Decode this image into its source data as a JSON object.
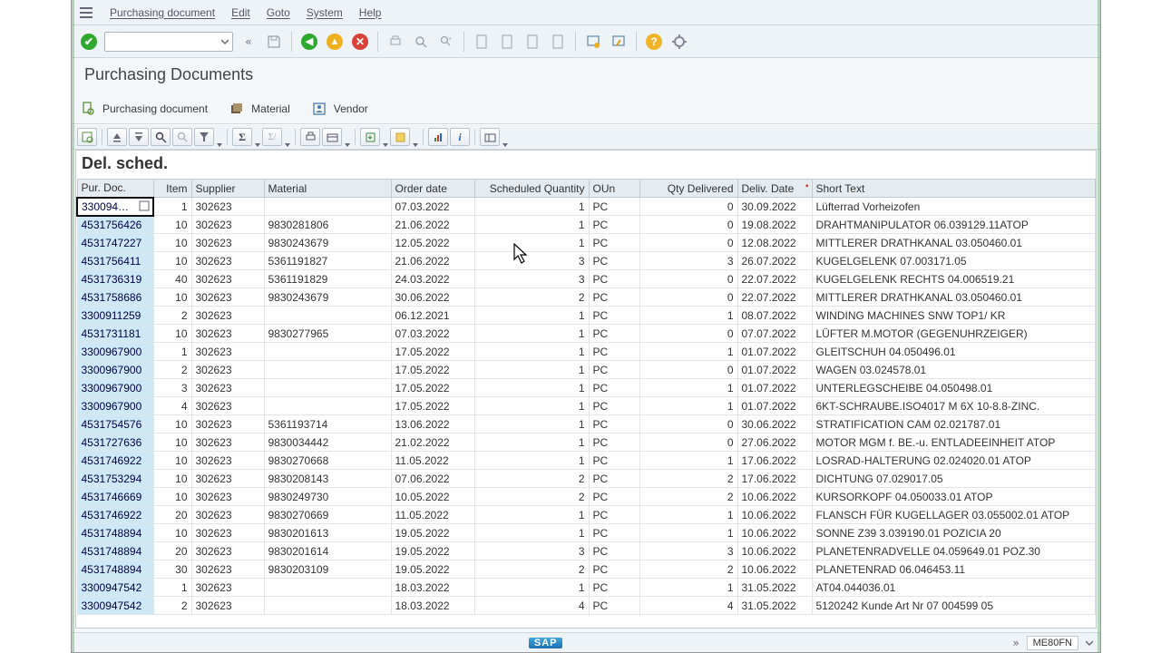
{
  "menu": {
    "items": [
      "Purchasing document",
      "Edit",
      "Goto",
      "System",
      "Help"
    ]
  },
  "title": "Purchasing Documents",
  "subtoolbar": {
    "purchasing": "Purchasing document",
    "material": "Material",
    "vendor": "Vendor"
  },
  "grid_title": "Del. sched.",
  "columns": [
    "Pur. Doc.",
    "Item",
    "Supplier",
    "Material",
    "Order date",
    "Scheduled Quantity",
    "OUn",
    "Qty Delivered",
    "Deliv. Date",
    "Short Text"
  ],
  "col_align": [
    "left",
    "right",
    "left",
    "left",
    "left",
    "right",
    "left",
    "right",
    "left",
    "left"
  ],
  "sorted_col": 8,
  "rows": [
    [
      "330094…",
      "1",
      "302623",
      "",
      "07.03.2022",
      "1",
      "PC",
      "0",
      "30.09.2022",
      "Lüfterrad Vorheizofen"
    ],
    [
      "4531756426",
      "10",
      "302623",
      "9830281806",
      "21.06.2022",
      "1",
      "PC",
      "0",
      "19.08.2022",
      "DRAHTMANIPULATOR 06.039129.11ATOP"
    ],
    [
      "4531747227",
      "10",
      "302623",
      "9830243679",
      "12.05.2022",
      "1",
      "PC",
      "0",
      "12.08.2022",
      "MITTLERER DRATHKANAL 03.050460.01"
    ],
    [
      "4531756411",
      "10",
      "302623",
      "5361191827",
      "21.06.2022",
      "3",
      "PC",
      "3",
      "26.07.2022",
      "KUGELGELENK 07.003171.05"
    ],
    [
      "4531736319",
      "40",
      "302623",
      "5361191829",
      "24.03.2022",
      "3",
      "PC",
      "0",
      "22.07.2022",
      "KUGELGELENK RECHTS 04.006519.21"
    ],
    [
      "4531758686",
      "10",
      "302623",
      "9830243679",
      "30.06.2022",
      "2",
      "PC",
      "0",
      "22.07.2022",
      "MITTLERER DRATHKANAL 03.050460.01"
    ],
    [
      "3300911259",
      "2",
      "302623",
      "",
      "06.12.2021",
      "1",
      "PC",
      "1",
      "08.07.2022",
      "WINDING MACHINES SNW TOP1/ KR"
    ],
    [
      "4531731181",
      "10",
      "302623",
      "9830277965",
      "07.03.2022",
      "1",
      "PC",
      "0",
      "07.07.2022",
      "LÜFTER M.MOTOR (GEGENUHRZEIGER)"
    ],
    [
      "3300967900",
      "1",
      "302623",
      "",
      "17.05.2022",
      "1",
      "PC",
      "1",
      "01.07.2022",
      "GLEITSCHUH 04.050496.01"
    ],
    [
      "3300967900",
      "2",
      "302623",
      "",
      "17.05.2022",
      "1",
      "PC",
      "0",
      "01.07.2022",
      "WAGEN  03.024578.01"
    ],
    [
      "3300967900",
      "3",
      "302623",
      "",
      "17.05.2022",
      "1",
      "PC",
      "1",
      "01.07.2022",
      "UNTERLEGSCHEIBE  04.050498.01"
    ],
    [
      "3300967900",
      "4",
      "302623",
      "",
      "17.05.2022",
      "1",
      "PC",
      "1",
      "01.07.2022",
      "6KT-SCHRAUBE.ISO4017 M 6X 10-8.8-ZINC."
    ],
    [
      "4531754576",
      "10",
      "302623",
      "5361193714",
      "13.06.2022",
      "1",
      "PC",
      "0",
      "30.06.2022",
      "STRATIFICATION CAM 02.021787.01"
    ],
    [
      "4531727636",
      "10",
      "302623",
      "9830034442",
      "21.02.2022",
      "1",
      "PC",
      "0",
      "27.06.2022",
      "MOTOR MGM  f. BE.-u. ENTLADEEINHEIT ATOP"
    ],
    [
      "4531746922",
      "10",
      "302623",
      "9830270668",
      "11.05.2022",
      "1",
      "PC",
      "1",
      "17.06.2022",
      "LOSRAD-HALTERUNG  02.024020.01 ATOP"
    ],
    [
      "4531753294",
      "10",
      "302623",
      "9830208143",
      "07.06.2022",
      "2",
      "PC",
      "2",
      "17.06.2022",
      "DICHTUNG 07.029017.05"
    ],
    [
      "4531746669",
      "10",
      "302623",
      "9830249730",
      "10.05.2022",
      "2",
      "PC",
      "2",
      "10.06.2022",
      "KURSORKOPF 04.050033.01 ATOP"
    ],
    [
      "4531746922",
      "20",
      "302623",
      "9830270669",
      "11.05.2022",
      "1",
      "PC",
      "1",
      "10.06.2022",
      "FLANSCH FÜR KUGELLAGER 03.055002.01 ATOP"
    ],
    [
      "4531748894",
      "10",
      "302623",
      "9830201613",
      "19.05.2022",
      "1",
      "PC",
      "1",
      "10.06.2022",
      "SONNE Z39 3.039190.01 POZICIA 20"
    ],
    [
      "4531748894",
      "20",
      "302623",
      "9830201614",
      "19.05.2022",
      "3",
      "PC",
      "3",
      "10.06.2022",
      "PLANETENRADVELLE 04.059649.01 POZ.30"
    ],
    [
      "4531748894",
      "30",
      "302623",
      "9830203109",
      "19.05.2022",
      "2",
      "PC",
      "2",
      "10.06.2022",
      "PLANETENRAD 06.046453.11"
    ],
    [
      "3300947542",
      "1",
      "302623",
      "",
      "18.03.2022",
      "1",
      "PC",
      "1",
      "31.05.2022",
      "AT04.044036.01"
    ],
    [
      "3300947542",
      "2",
      "302623",
      "",
      "18.03.2022",
      "4",
      "PC",
      "4",
      "31.05.2022",
      "5120242 Kunde Art Nr  07 004599 05"
    ]
  ],
  "status": {
    "tcode": "ME80FN"
  }
}
